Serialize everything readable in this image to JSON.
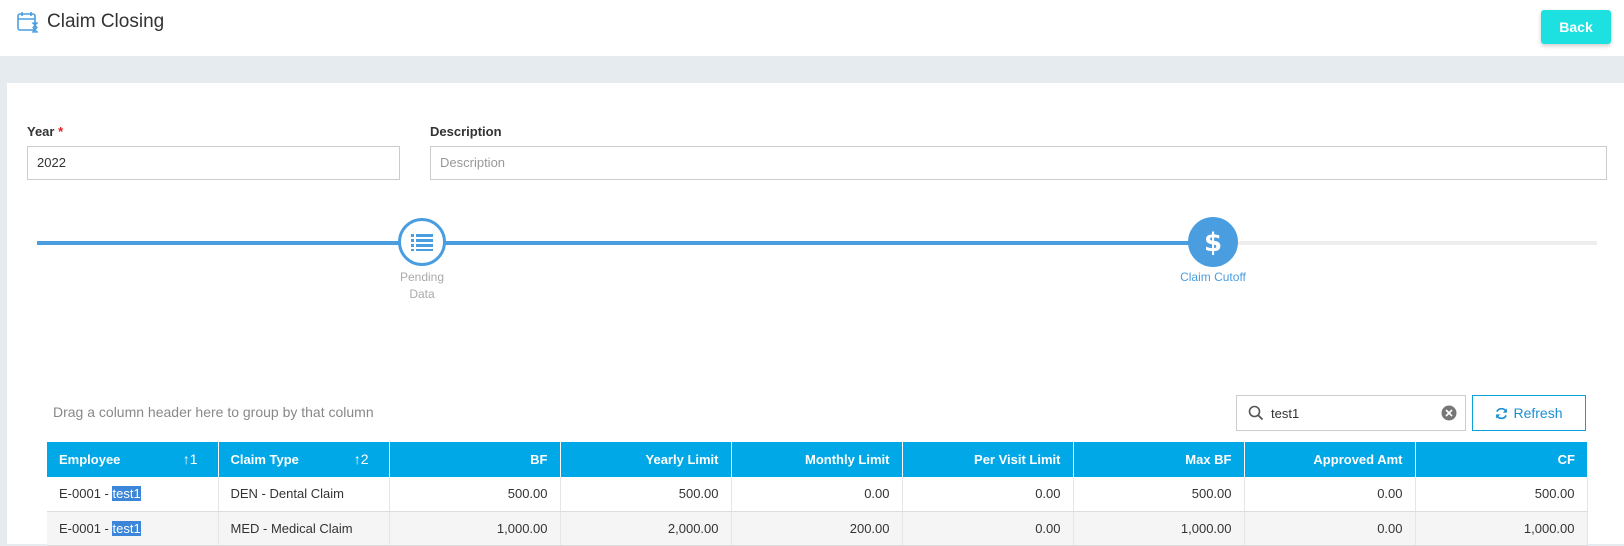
{
  "header": {
    "title": "Claim Closing",
    "back_label": "Back"
  },
  "form": {
    "year_label": "Year",
    "year_required_mark": "*",
    "year_value": "2022",
    "description_label": "Description",
    "description_placeholder": "Description",
    "description_value": ""
  },
  "steps": [
    {
      "label_line1": "Pending",
      "label_line2": "Data",
      "icon": "list-icon",
      "state": "completed"
    },
    {
      "label": "Claim Cutoff",
      "icon": "dollar-icon",
      "state": "active"
    }
  ],
  "grid": {
    "group_hint": "Drag a column header here to group by that column",
    "search_value": "test1",
    "refresh_label": "Refresh",
    "columns": [
      "Employee",
      "Claim Type",
      "BF",
      "Yearly Limit",
      "Monthly Limit",
      "Per Visit Limit",
      "Max BF",
      "Approved Amt",
      "CF"
    ],
    "sort_indicators": {
      "employee": "1",
      "claim_type": "2"
    },
    "rows": [
      {
        "employee_prefix": "E-0001 - ",
        "employee_match": "test1",
        "claim_type": "DEN - Dental Claim",
        "bf": "500.00",
        "yearly_limit": "500.00",
        "monthly_limit": "0.00",
        "per_visit_limit": "0.00",
        "max_bf": "500.00",
        "approved_amt": "0.00",
        "cf": "500.00"
      },
      {
        "employee_prefix": "E-0001 - ",
        "employee_match": "test1",
        "claim_type": "MED - Medical Claim",
        "bf": "1,000.00",
        "yearly_limit": "2,000.00",
        "monthly_limit": "200.00",
        "per_visit_limit": "0.00",
        "max_bf": "1,000.00",
        "approved_amt": "0.00",
        "cf": "1,000.00"
      }
    ]
  },
  "colors": {
    "accent": "#4a9ee0",
    "header_bg": "#00a8e8",
    "back_button": "#1de1e1",
    "highlight": "#3b86d9"
  }
}
